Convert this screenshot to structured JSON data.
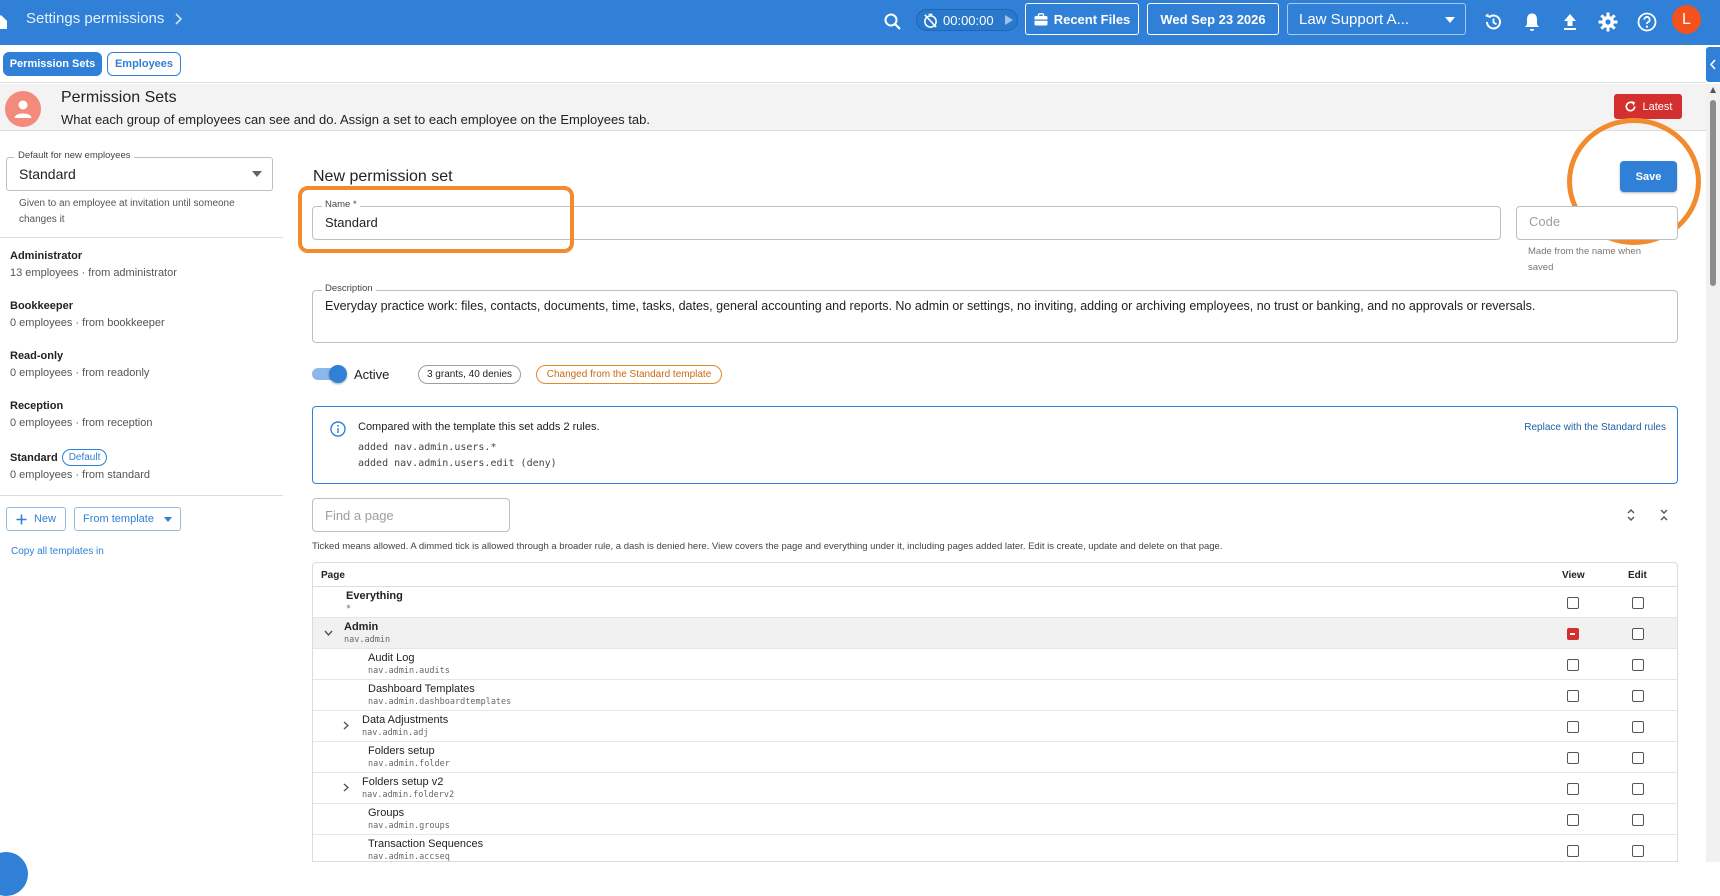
{
  "topbar": {
    "breadcrumb": "Settings permissions",
    "timer": "00:00:00",
    "recent_files_label": "Recent Files",
    "date_label": "Wed Sep 23 2026",
    "org_select_value": "Law Support A...",
    "avatar_initial": "L",
    "icons": [
      "home-icon",
      "search-icon",
      "timer-off-icon",
      "play-icon",
      "briefcase-icon",
      "history-icon",
      "bell-icon",
      "upload-icon",
      "gear-icon",
      "help-icon"
    ]
  },
  "tabs": [
    {
      "label": "Permission Sets",
      "active": true
    },
    {
      "label": "Employees",
      "active": false
    }
  ],
  "header": {
    "title": "Permission Sets",
    "subtitle": "What each group of employees can see and do. Assign a set to each employee on the Employees tab.",
    "latest_label": "Latest"
  },
  "sidebar": {
    "default_legend": "Default for new employees",
    "default_value": "Standard",
    "default_help": "Given to an employee at invitation until someone changes it",
    "sets": [
      {
        "name": "Administrator",
        "meta": "13 employees · from administrator"
      },
      {
        "name": "Bookkeeper",
        "meta": "0 employees · from bookkeeper"
      },
      {
        "name": "Read-only",
        "meta": "0 employees · from readonly"
      },
      {
        "name": "Reception",
        "meta": "0 employees · from reception"
      },
      {
        "name": "Standard",
        "meta": "0 employees · from standard",
        "chip": "Default"
      }
    ],
    "new_label": "New",
    "from_template_label": "From template",
    "copy_link": "Copy all templates in"
  },
  "form": {
    "title": "New permission set",
    "save_label": "Save",
    "name_legend": "Name *",
    "name_value": "Standard",
    "code_placeholder": "Code",
    "code_help": "Made from the name when saved",
    "description_legend": "Description",
    "description_value": "Everyday practice work: files, contacts, documents, time, tasks, dates, general accounting and reports. No admin or settings, no inviting, adding or archiving employees, no trust or banking, and no approvals or reversals.",
    "active_label": "Active",
    "active": true,
    "counts_pill": "3 grants, 40 denies",
    "changed_pill": "Changed from the Standard template"
  },
  "compare": {
    "heading": "Compared with the template this set adds 2 rules.",
    "lines": [
      "added nav.admin.users.*",
      "added nav.admin.users.edit (deny)"
    ],
    "replace_link": "Replace with the Standard rules"
  },
  "pages": {
    "find_placeholder": "Find a page",
    "hint": "Ticked means allowed. A dimmed tick is allowed through a broader rule, a dash is denied here. View covers the page and everything under it, including pages added later. Edit is create, update and delete on that page.",
    "columns": {
      "page": "Page",
      "view": "View",
      "edit": "Edit"
    },
    "rows": [
      {
        "name": "Everything",
        "key": "*",
        "level": 0,
        "view": "unchecked",
        "edit": "unchecked"
      },
      {
        "name": "Admin",
        "key": "nav.admin",
        "level": 0,
        "expanded": true,
        "view": "denied",
        "edit": "unchecked"
      },
      {
        "name": "Audit Log",
        "key": "nav.admin.audits",
        "level": 1,
        "view": "unchecked",
        "edit": "unchecked"
      },
      {
        "name": "Dashboard Templates",
        "key": "nav.admin.dashboardtemplates",
        "level": 1,
        "view": "unchecked",
        "edit": "unchecked"
      },
      {
        "name": "Data Adjustments",
        "key": "nav.admin.adj",
        "level": 1,
        "collapsed": true,
        "view": "unchecked",
        "edit": "unchecked"
      },
      {
        "name": "Folders setup",
        "key": "nav.admin.folder",
        "level": 1,
        "view": "unchecked",
        "edit": "unchecked"
      },
      {
        "name": "Folders setup v2",
        "key": "nav.admin.folderv2",
        "level": 1,
        "collapsed": true,
        "view": "unchecked",
        "edit": "unchecked"
      },
      {
        "name": "Groups",
        "key": "nav.admin.groups",
        "level": 1,
        "view": "unchecked",
        "edit": "unchecked"
      },
      {
        "name": "Transaction Sequences",
        "key": "nav.admin.accseq",
        "level": 1,
        "view": "unchecked",
        "edit": "unchecked"
      }
    ]
  },
  "colors": {
    "brand": "#2f80d6",
    "danger": "#d32f2f",
    "highlight_ring": "#f28b2d",
    "avatar": "#f4511e"
  }
}
